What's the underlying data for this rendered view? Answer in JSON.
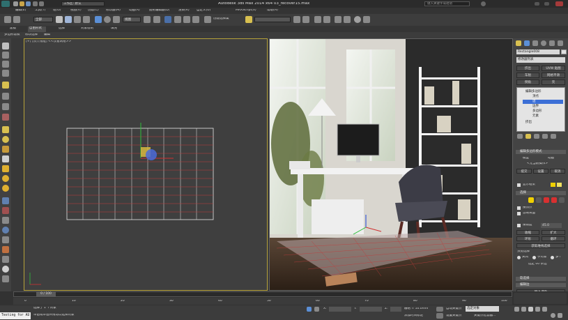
{
  "app": {
    "title": "Autodesk 3ds Max  2014 x64      03_recover15.max",
    "workspace": "工作区: 默认",
    "search_placeholder": "键入关键字或短语",
    "logo_text": "S"
  },
  "menu": [
    "编辑(E)",
    "工具(T)",
    "组(G)",
    "视图(V)",
    "创建(C)",
    "修改器(M)",
    "动画(A)",
    "图形编辑器(D)",
    "渲染(R)",
    "自定义(U)",
    "MAXScript(X)",
    "帮助(H)"
  ],
  "toolbar": {
    "selection_filter": "全部",
    "view_mode": "视图",
    "select_by_name": "按名称选择",
    "create_selection": "创建选择集"
  },
  "ribbon": {
    "tabs": [
      "建模",
      "自由形式",
      "选择",
      "对象绘制",
      "填充"
    ],
    "subtabs": [
      "多边形建模",
      "修改选择",
      "编辑"
    ]
  },
  "viewport_left": {
    "label": "[+] [顶] [线框] <<仅看网格>>",
    "ruler_label": "0 / 100"
  },
  "command_panel": {
    "object_name": "Rectangle008",
    "modifier_list": "修改器列表",
    "buttons": [
      "挤出",
      "UVW 贴图",
      "车削",
      "网格平滑",
      "倒角",
      "壳"
    ],
    "stack": {
      "items": [
        "编辑多边形",
        "顶点",
        "边",
        "边界",
        "多边形",
        "元素",
        "挤出"
      ],
      "selected_index": 2
    },
    "section_edit_poly": "编辑多边形模式",
    "model_label": "模型",
    "anim_label": "动画",
    "no_current": "<无当前操作>",
    "commit": "提交",
    "settings": "设置",
    "cancel": "取消",
    "show_cage": "显示框架",
    "section_select": "选择",
    "by_vertex": "按顶点",
    "ignore_backfacing": "忽略背面",
    "by_angle": "按角度",
    "angle_value": "45.0",
    "shrink": "收缩",
    "grow": "扩大",
    "ring": "环形",
    "loop": "循环",
    "get_stack_sel": "获取堆栈选择",
    "preview_sel": "预览选择",
    "off": "关闭",
    "subobj": "子对象",
    "multi": "多个",
    "sel_count": "选定 00 条边",
    "section_soft": "软选择",
    "section_edit_edges": "编辑边",
    "insert_vertex": "插入顶点",
    "remove": "移除",
    "split": "分割"
  },
  "timeline": {
    "counter": "0 / 100",
    "ticks": [
      "0",
      "5",
      "10",
      "15",
      "20",
      "25",
      "30",
      "35",
      "40",
      "45",
      "50",
      "55",
      "60",
      "65",
      "70",
      "75",
      "80",
      "85",
      "90",
      "95",
      "100"
    ]
  },
  "status": {
    "script_label": "Testing for AU",
    "selection": "选择了 1 个对象",
    "hint": "单击或单击并拖动以选择对象",
    "x_label": "X:",
    "y_label": "Y:",
    "z_label": "Z:",
    "grid": "栅格 = 10.0mm",
    "autokey": "自动关键点",
    "set_key": "设置关键点",
    "selected_obj": "选定对象",
    "key_filters": "关键点过滤器...",
    "add_time_tag": "添加时间标记"
  },
  "colors": {
    "selected_viewport_border": "#b7a33a",
    "stack_highlight": "#3c6fd6",
    "grid_red": "#c33a3a",
    "accent_yellow": "#f0d000"
  }
}
